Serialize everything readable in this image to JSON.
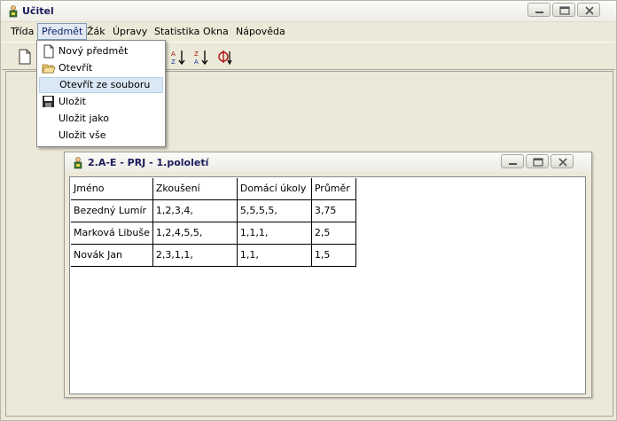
{
  "app": {
    "title": "Učitel"
  },
  "menubar": {
    "items": [
      "Třída",
      "Předmět",
      "Žák",
      "Úpravy",
      "Statistika",
      "Okna",
      "Nápověda"
    ],
    "active_index": 1
  },
  "dropdown": {
    "items": [
      {
        "label": "Nový předmět",
        "icon": "new-document-icon"
      },
      {
        "label": "Otevřít",
        "icon": "open-folder-icon"
      },
      {
        "label": "Otevřít ze souboru",
        "icon": "",
        "highlighted": true
      },
      {
        "label": "Uložit",
        "icon": "floppy-disk-icon"
      },
      {
        "label": "Uložit jako",
        "icon": ""
      },
      {
        "label": "Uložit vše",
        "icon": ""
      }
    ]
  },
  "toolbar": {
    "buttons": [
      "new-document-icon",
      "sort-az-icon",
      "sort-za-icon",
      "phi-icon"
    ]
  },
  "child_window": {
    "title": "2.A-E - PRJ - 1.pololetí"
  },
  "grid": {
    "headers": [
      "Jméno",
      "Zkoušení",
      "Domácí úkoly",
      "Průměr"
    ],
    "rows": [
      [
        "Bezedný Lumír",
        "1,2,3,4,",
        "5,5,5,5,",
        "3,75"
      ],
      [
        "Marková Libuše",
        "1,2,4,5,5,",
        "1,1,1,",
        "2,5"
      ],
      [
        "Novák Jan",
        "2,3,1,1,",
        "1,1,",
        "1,5"
      ]
    ]
  }
}
